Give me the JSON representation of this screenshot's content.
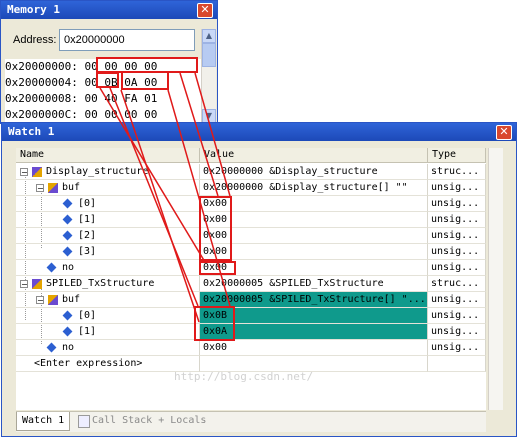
{
  "memory_window": {
    "title": "Memory 1",
    "close_glyph": "✕",
    "address_label": "Address:",
    "address_value": "0x20000000",
    "lines": [
      "0x20000000: 00 00 00 00",
      "0x20000004: 00 0B 0A 00",
      "0x20000008: 00 40 FA 01",
      "0x2000000C: 00 00 00 00"
    ]
  },
  "watch_window": {
    "title": "Watch 1",
    "close_glyph": "✕",
    "headers": {
      "name": "Name",
      "value": "Value",
      "type": "Type"
    },
    "rows": [
      {
        "name": "Display_structure",
        "value": "0x20000000 &Display_structure",
        "type": "struc..."
      },
      {
        "name": "buf",
        "value": "0x20000000 &Display_structure[] \"\"",
        "type": "unsig..."
      },
      {
        "name": "[0]",
        "value": "0x00",
        "type": "unsig..."
      },
      {
        "name": "[1]",
        "value": "0x00",
        "type": "unsig..."
      },
      {
        "name": "[2]",
        "value": "0x00",
        "type": "unsig..."
      },
      {
        "name": "[3]",
        "value": "0x00",
        "type": "unsig..."
      },
      {
        "name": "no",
        "value": "0x00",
        "type": "unsig..."
      },
      {
        "name": "SPILED_TxStructure",
        "value": "0x20000005 &SPILED_TxStructure",
        "type": "struc..."
      },
      {
        "name": "buf",
        "value": "0x20000005 &SPILED_TxStructure[] \"...",
        "type": "unsig..."
      },
      {
        "name": "[0]",
        "value": "0x0B",
        "type": "unsig..."
      },
      {
        "name": "[1]",
        "value": "0x0A",
        "type": "unsig..."
      },
      {
        "name": "no",
        "value": "0x00",
        "type": "unsig..."
      },
      {
        "name": "<Enter expression>",
        "value": "",
        "type": ""
      }
    ],
    "tabs": [
      {
        "label": "Watch 1"
      },
      {
        "label": "Call Stack + Locals"
      }
    ]
  },
  "watermark": "http://blog.csdn.net/",
  "colors": {
    "highlight": "#0f9a8c",
    "annotation": "#e01a1a",
    "titlebar": "#2a55c5"
  }
}
